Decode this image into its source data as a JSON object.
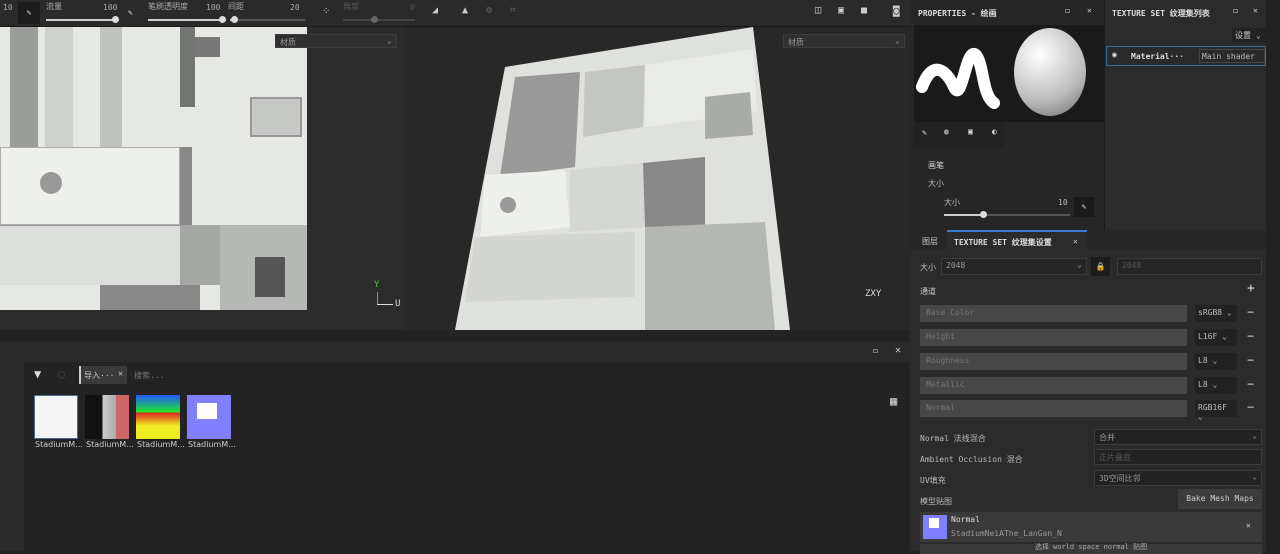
{
  "toolbar": {
    "size_value": "10",
    "flow_label": "流量",
    "flow_value": "100",
    "opacity_label": "笔刷透明度",
    "opacity_value": "100",
    "spacing_label": "间距",
    "spacing_value": "20",
    "angle_label": "角度",
    "angle_value": "0",
    "flow_pct": 100,
    "opacity_pct": 100,
    "spacing_pct": 20
  },
  "viewport2d": {
    "dropdown": "材质",
    "axis_y": "Y",
    "axis_u": "U"
  },
  "viewport3d": {
    "dropdown": "材质",
    "axis": "ZXY"
  },
  "properties": {
    "title": "PROPERTIES - 绘画",
    "section": "画笔",
    "group": "大小",
    "size_label": "大小",
    "size_value": "10",
    "size_pct": 10
  },
  "texture_set_list": {
    "title": "TEXTURE SET 纹理集列表",
    "settings": "设置",
    "material": "Material···",
    "shader": "Main shader"
  },
  "texture_set_settings": {
    "tab_layers": "图层",
    "tab_title": "TEXTURE SET 纹理集设置",
    "size_label": "大小",
    "size_value": "2048",
    "size_value2": "2048",
    "channels_label": "通道",
    "channels": [
      {
        "name": "Base Color",
        "format": "sRGB8"
      },
      {
        "name": "Height",
        "format": "L16F"
      },
      {
        "name": "Roughness",
        "format": "L8"
      },
      {
        "name": "Metallic",
        "format": "L8"
      },
      {
        "name": "Normal",
        "format": "RGB16F"
      }
    ],
    "normal_blend_label": "Normal 法线混合",
    "normal_blend_value": "合并",
    "ao_blend_label": "Ambient Occlusion 混合",
    "ao_blend_value": "正片叠底",
    "uv_label": "UV填充",
    "uv_value": "3D空间比邻",
    "mesh_maps_label": "模型贴图",
    "bake_button": "Bake Mesh Maps",
    "map_name": "Normal",
    "map_file": "StadiumNeiAThe_LanGan_N",
    "select_world": "选择 world space normal 贴图"
  },
  "shelf": {
    "tab": "导入···",
    "search_placeholder": "搜索...",
    "items": [
      "StadiumM...",
      "StadiumM...",
      "StadiumM...",
      "StadiumM..."
    ]
  }
}
